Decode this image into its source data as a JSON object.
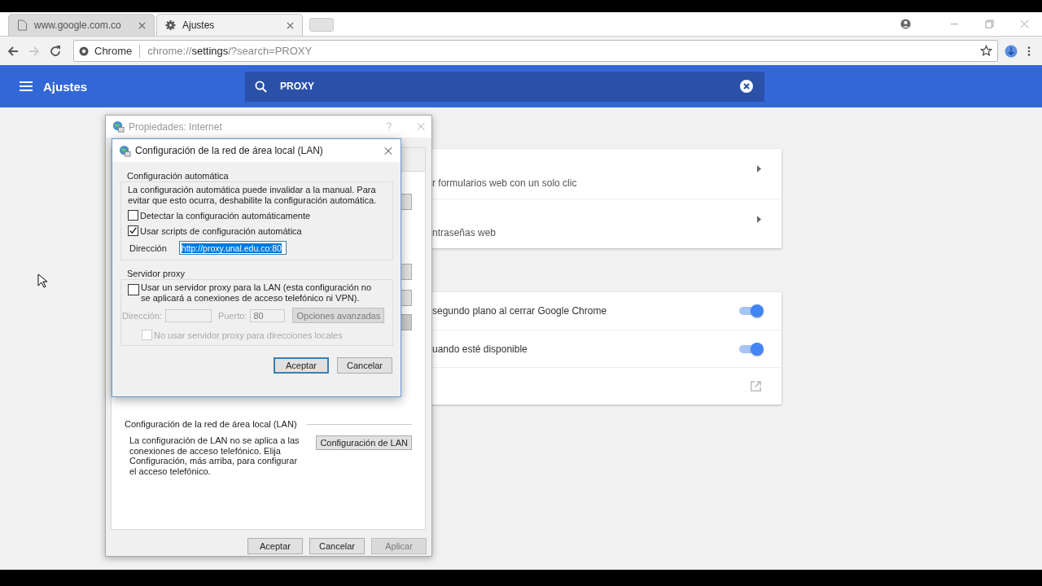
{
  "browser": {
    "tabs": [
      {
        "title": "www.google.com.co",
        "selected": false
      },
      {
        "title": "Ajustes",
        "selected": true
      }
    ],
    "address": {
      "origin": "Chrome",
      "scheme": "chrome://",
      "host": "settings",
      "path": "/?search=PROXY"
    }
  },
  "header": {
    "title": "Ajustes",
    "search": "PROXY"
  },
  "cards": [
    {
      "items": [
        {
          "kind": "arrow",
          "text": "r formularios web con un solo clic"
        },
        {
          "kind": "arrow",
          "text": "ntraseñas web"
        }
      ]
    },
    {
      "items": [
        {
          "kind": "toggle",
          "text": "segundo plano al cerrar Google Chrome",
          "on": true
        },
        {
          "kind": "toggle",
          "text": "uando esté disponible",
          "on": true
        },
        {
          "kind": "external"
        }
      ]
    }
  ],
  "properties_window": {
    "title": "Propiedades: Internet",
    "lan_heading": "Configuración de la red de área local (LAN)",
    "lan_text": "La configuración de LAN no se aplica a las conexiones de acceso telefónico. Elija Configuración, más arriba, para configurar el acceso telefónico.",
    "lan_button": "Configuración de LAN",
    "buttons": [
      {
        "label": "Aceptar",
        "disabled": false
      },
      {
        "label": "Cancelar",
        "disabled": false
      },
      {
        "label": "Aplicar",
        "disabled": true
      }
    ]
  },
  "lan_dialog": {
    "title": "Configuración de la red de área local (LAN)",
    "auto_group": {
      "title": "Configuración automática",
      "text": "La configuración automática puede invalidar a la manual. Para evitar que esto ocurra, deshabilite la configuración automática.",
      "checkboxes": [
        {
          "label": "Detectar la configuración automáticamente",
          "checked": false
        },
        {
          "label": "Usar scripts de configuración automática",
          "checked": true
        }
      ],
      "address_label": "Dirección",
      "address_value": "http://proxy.unal.edu.co:80"
    },
    "proxy_group": {
      "title": "Servidor proxy",
      "checkbox": {
        "label": "Usar un servidor proxy para la LAN (esta configuración no se aplicará a conexiones de acceso telefónico ni VPN).",
        "checked": false
      },
      "address_label": "Dirección:",
      "port_label": "Puerto:",
      "port_value": "80",
      "advanced_button": "Opciones avanzadas",
      "bypass": {
        "label": "No usar servidor proxy para direcciones locales",
        "checked": false,
        "disabled": true
      }
    },
    "buttons": [
      {
        "label": "Aceptar",
        "default": true
      },
      {
        "label": "Cancelar",
        "default": false
      }
    ]
  }
}
